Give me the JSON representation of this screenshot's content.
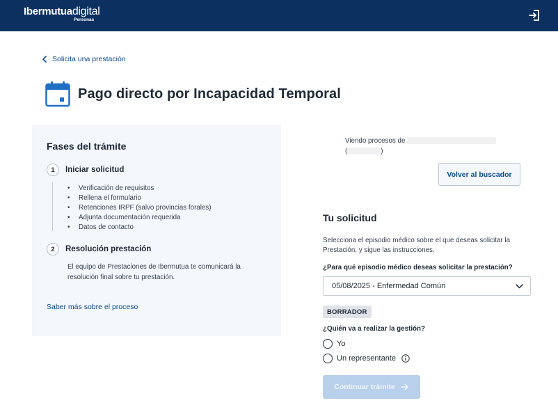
{
  "header": {
    "logo_brand": "Ibermutua",
    "logo_suffix": "digital",
    "logo_sub": "Personas",
    "logout_icon": "logout-icon",
    "bg_color": "#0c3160"
  },
  "breadcrumb": {
    "back_label": "Solicita una prestación"
  },
  "page": {
    "title": "Pago directo por Incapacidad Temporal",
    "icon": "calendar-icon"
  },
  "phases": {
    "heading": "Fases del trámite",
    "steps": [
      {
        "num": "1",
        "title": "Iniciar solicitud",
        "items": [
          "Verificación de requisitos",
          "Rellena el formulario",
          "Retenciones IRPF (salvo provincias forales)",
          "Adjunta documentación requerida",
          "Datos de contacto"
        ]
      },
      {
        "num": "2",
        "title": "Resolución prestación",
        "description": "El equipo de Prestaciones de Ibermutua te comunicará la resolución final sobre tu prestación."
      }
    ],
    "learn_more": "Saber más sobre el proceso"
  },
  "viewing": {
    "prefix": "Viendo procesos de",
    "open_paren": "(",
    "close_paren": ")"
  },
  "back_to_search": "Volver al buscador",
  "request": {
    "title": "Tu solicitud",
    "description": "Selecciona el episodio médico sobre el que deseas solicitar la Prestación, y sigue las instrucciones.",
    "episode_question": "¿Para qué episodio médico deseas solicitar la prestación?",
    "episode_selected": "05/08/2025 - Enfermedad Común",
    "status_badge": "BORRADOR",
    "who_question": "¿Quién va a realizar la gestión?",
    "options": [
      "Yo",
      "Un representante"
    ],
    "continue_label": "Continuar trámite"
  },
  "colors": {
    "accent": "#0c4a8a",
    "calendar_icon": "#1f6fc2",
    "panel_bg": "#f4f7fb",
    "disabled_button": "#b9d0ea"
  }
}
